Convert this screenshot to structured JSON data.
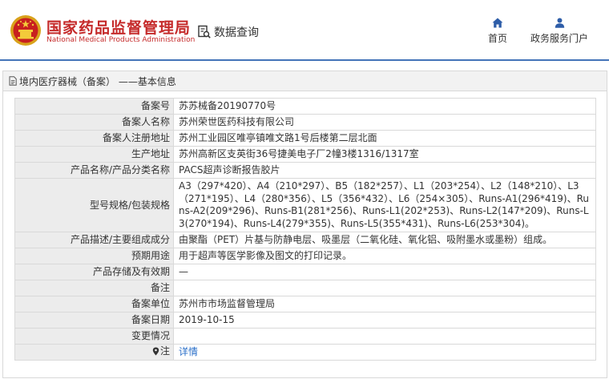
{
  "header": {
    "logo_cn": "国家药品监督管理局",
    "logo_en": "National Medical Products Administration",
    "query_label": "数据查询",
    "nav": [
      {
        "label": "首页",
        "icon": "home-icon"
      },
      {
        "label": "政务服务门户",
        "icon": "user-icon"
      }
    ],
    "accent_color": "#4474b8",
    "brand_color": "#c52a2a"
  },
  "panel": {
    "title": "境内医疗器械（备案） ——基本信息"
  },
  "rows": [
    {
      "label": "备案号",
      "value": "苏苏械备20190770号"
    },
    {
      "label": "备案人名称",
      "value": "苏州荣世医药科技有限公司"
    },
    {
      "label": "备案人注册地址",
      "value": "苏州工业园区唯亭镇唯文路1号后楼第二层北面"
    },
    {
      "label": "生产地址",
      "value": "苏州高新区支英街36号捷美电子厂2幢3楼1316/1317室"
    },
    {
      "label": "产品名称/产品分类名称",
      "value": "PACS超声诊断报告胶片"
    },
    {
      "label": "型号规格/包装规格",
      "value": "A3（297*420）、A4（210*297）、B5（182*257）、L1（203*254）、L2（148*210）、L3（271*195）、L4（280*356）、L5（356*432）、L6（254×305）、Runs-A1(296*419)、Runs-A2(209*296)、Runs-B1(281*256)、Runs-L1(202*253)、Runs-L2(147*209)、Runs-L3(270*194)、Runs-L4(279*355)、Runs-L5(355*431)、Runs-L6(253*304)。"
    },
    {
      "label": "产品描述/主要组成成分",
      "value": "由聚酯（PET）片基与防静电层、吸墨层（二氧化硅、氧化铝、吸附墨水或墨粉）组成。"
    },
    {
      "label": "预期用途",
      "value": "用于超声等医学影像及图文的打印记录。"
    },
    {
      "label": "产品存储及有效期",
      "value": "—"
    },
    {
      "label": "备注",
      "value": ""
    },
    {
      "label": "备案单位",
      "value": "苏州市市场监督管理局"
    },
    {
      "label": "备案日期",
      "value": "2019-10-15"
    },
    {
      "label": "变更情况",
      "value": ""
    },
    {
      "label": "注",
      "value": "详情"
    }
  ]
}
